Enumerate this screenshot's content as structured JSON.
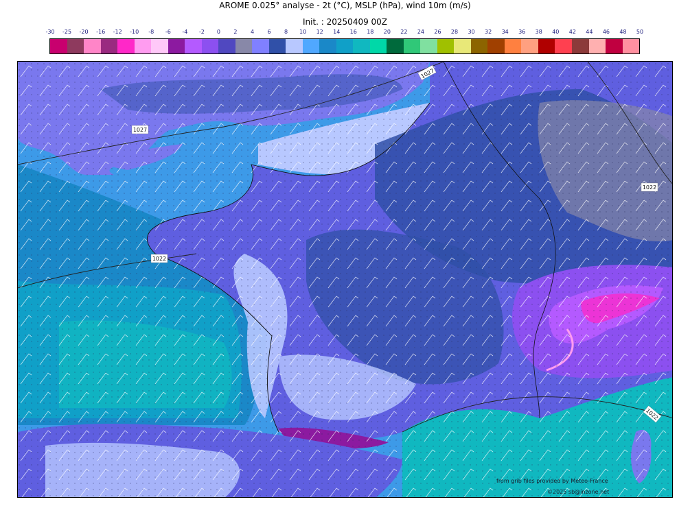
{
  "header": {
    "title": "AROME 0.025° analyse - 2t (°C), MSLP (hPa), wind 10m (m/s)",
    "init": "Init. : 20250409 00Z"
  },
  "legend": {
    "ticks": [
      "-30",
      "-25",
      "-20",
      "-16",
      "-12",
      "-10",
      "-8",
      "-6",
      "-4",
      "-2",
      "0",
      "2",
      "4",
      "6",
      "8",
      "10",
      "12",
      "14",
      "16",
      "18",
      "20",
      "22",
      "24",
      "26",
      "28",
      "30",
      "32",
      "34",
      "36",
      "38",
      "40",
      "42",
      "44",
      "46",
      "48",
      "50"
    ],
    "colors": [
      "#c8006e",
      "#8e3a5e",
      "#ff85c8",
      "#9a2a80",
      "#ff28c8",
      "#ff9cf0",
      "#ffc8f8",
      "#8c1aa0",
      "#b45aff",
      "#8c50f0",
      "#5048c0",
      "#8888a8",
      "#8080ff",
      "#3050a8",
      "#b8c8ff",
      "#50a8ff",
      "#1a88c8",
      "#10a0c8",
      "#10b8c0",
      "#00d8a8",
      "#006a3c",
      "#30c878",
      "#80e0a0",
      "#a0c000",
      "#e8e878",
      "#8c6400",
      "#a04000",
      "#ff8040",
      "#ffa080",
      "#b00000",
      "#ff4050",
      "#8c3a3a",
      "#ffb0b0",
      "#c00040",
      "#ff90a0"
    ]
  },
  "map": {
    "isobar_labels": [
      "1027",
      "1027",
      "1022",
      "1022",
      "1022"
    ]
  },
  "credits": {
    "source": "from grib files provided by Meteo-France",
    "copyright": "©2025 sb@inzone.net"
  }
}
